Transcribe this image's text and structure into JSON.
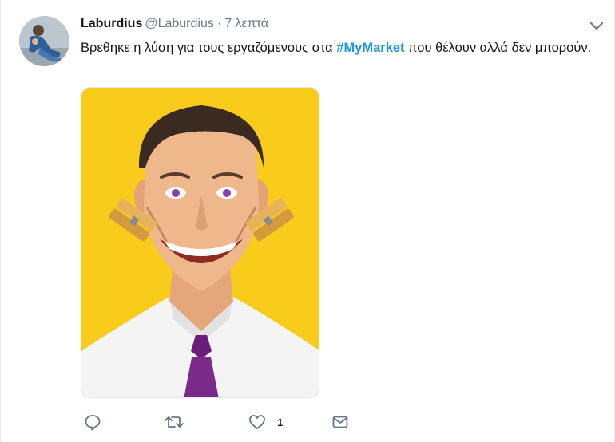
{
  "tweet": {
    "author_name": "Laburdius",
    "author_handle": "@Laburdius",
    "separator": "·",
    "time": "7 λεπτά",
    "text_before": "Βρεθηκε η λύση για τους εργαζόμενους στα ",
    "hashtag": "#MyMarket",
    "text_after": " που θέλουν αλλά δεν μπορούν.",
    "like_count": "1"
  },
  "icons": {
    "reply": "reply-icon",
    "retweet": "retweet-icon",
    "like": "heart-icon",
    "message": "envelope-icon",
    "menu": "chevron-down-icon"
  },
  "colors": {
    "hashtag": "#1b95e0",
    "secondary_text": "#657786",
    "icon": "#657786",
    "media_background": "#f9cb1b"
  }
}
